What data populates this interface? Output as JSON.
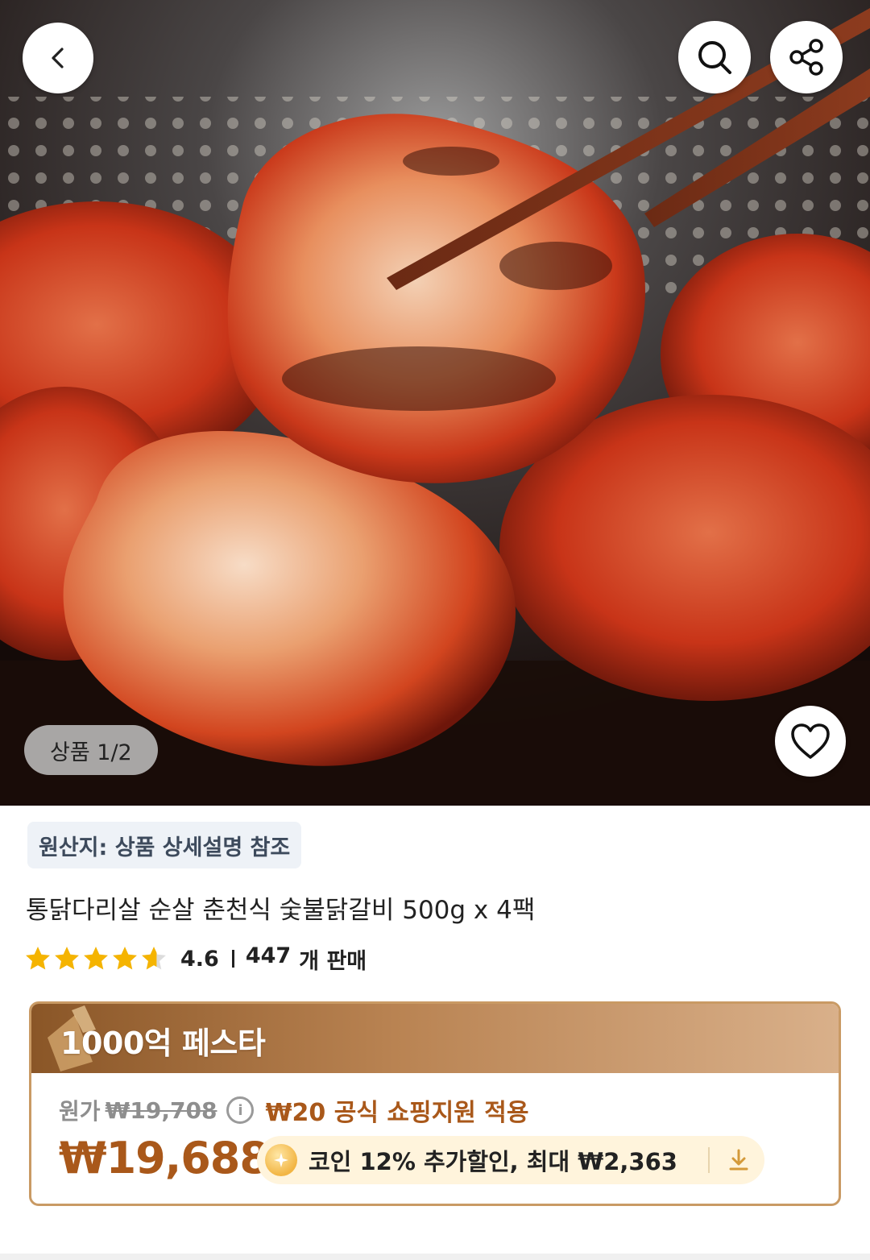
{
  "hero": {
    "image_subject": "grilled spicy chicken thigh pieces on charcoal grill with chopsticks",
    "counter_label": "상품 1/2"
  },
  "icons": {
    "back": "chevron-left-icon",
    "search": "search-icon",
    "share": "share-icon",
    "like": "heart-icon"
  },
  "product": {
    "origin": "원산지: 상품 상세설명 참조",
    "title": "통닭다리살 순살 춘천식 숯불닭갈비 500g x 4팩",
    "rating": 4.6,
    "rating_text": "4.6",
    "sold_count": "447",
    "sold_unit": "개 판매"
  },
  "promo": {
    "festival_label": "1000억 페스타",
    "original_price_label": "원가",
    "original_price": "₩19,708",
    "support_text": "₩20 공식 쇼핑지원 적용",
    "final_price": "₩19,688",
    "coin_text": "코인 12% 추가할인, 최대 ₩2,363"
  },
  "colors": {
    "price_accent": "#a9581a",
    "star": "#f5b400",
    "card_border": "#c99a64",
    "coin_pill_bg": "#fff4dc"
  }
}
